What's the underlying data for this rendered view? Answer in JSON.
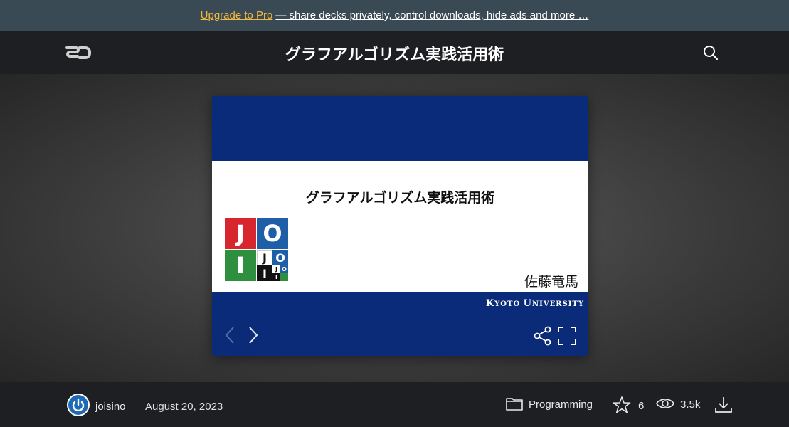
{
  "promo": {
    "link_label": "Upgrade to Pro",
    "text": "— share decks privately, control downloads, hide ads and more …"
  },
  "header": {
    "logo_text": "SD",
    "title": "グラフアルゴリズム実践活用術"
  },
  "slide": {
    "title": "グラフアルゴリズム実践活用術",
    "author": "佐藤竜馬",
    "university_k": "K",
    "university_yoto": "YOTO ",
    "university_u": "U",
    "university_niversity": "NIVERSITY",
    "logo_letters": [
      "J",
      "O",
      "I",
      "J",
      "O",
      "I",
      "J",
      "O",
      "I"
    ],
    "colors": {
      "navy": "#0a2a7a",
      "red": "#d7262d",
      "blue": "#1e5fa8",
      "green": "#2e8f3e",
      "black": "#111111"
    }
  },
  "controls": {
    "prev_icon": "chevron-left-icon",
    "next_icon": "chevron-right-icon",
    "share_icon": "share-icon",
    "fullscreen_icon": "fullscreen-icon"
  },
  "footer": {
    "username": "joisino",
    "date": "August 20, 2023",
    "category": "Programming",
    "stars": "6",
    "views": "3.5k"
  },
  "accent": "#f4b740"
}
